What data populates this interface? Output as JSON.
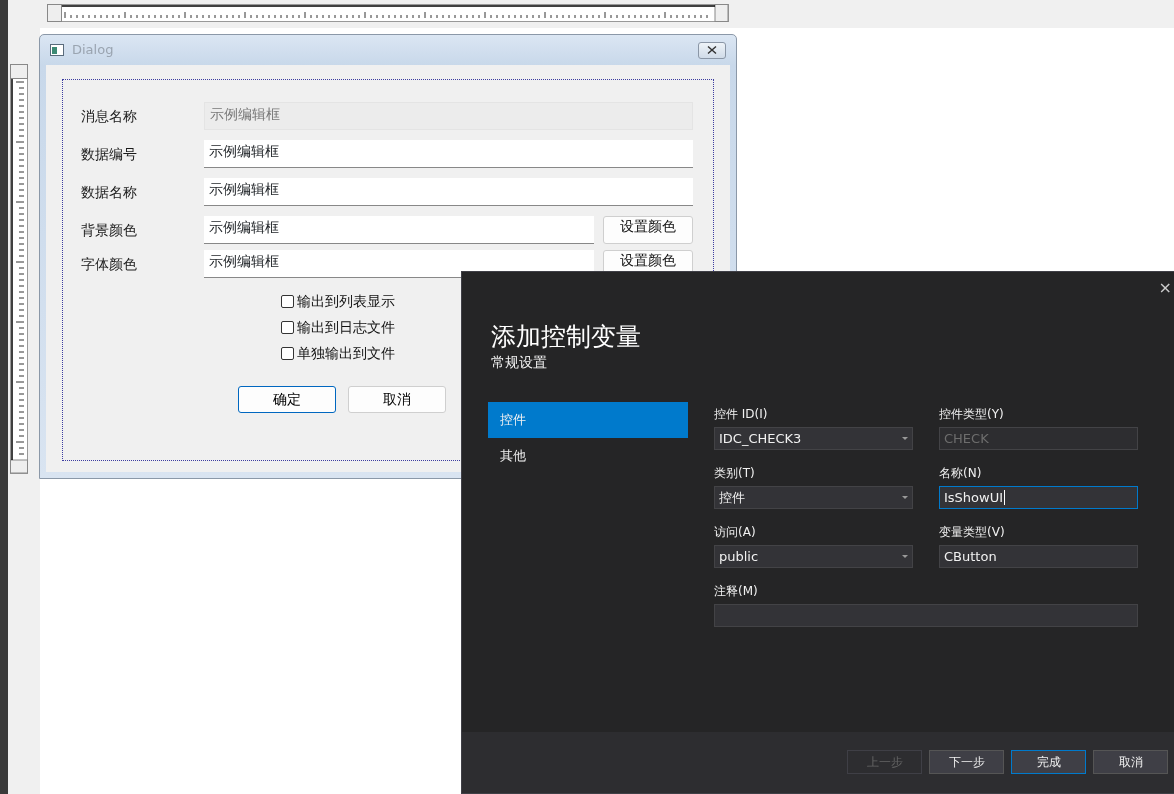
{
  "dialog": {
    "title": "Dialog",
    "fields": [
      {
        "label": "消息名称",
        "value": "示例编辑框",
        "disabled": true
      },
      {
        "label": "数据编号",
        "value": "示例编辑框",
        "disabled": false
      },
      {
        "label": "数据名称",
        "value": "示例编辑框",
        "disabled": false
      },
      {
        "label": "背景颜色",
        "value": "示例编辑框",
        "disabled": false,
        "button": "设置颜色"
      },
      {
        "label": "字体颜色",
        "value": "示例编辑框",
        "disabled": false,
        "button": "设置颜色"
      }
    ],
    "checkboxes": [
      {
        "label": "输出到列表显示",
        "checked": false
      },
      {
        "label": "输出到日志文件",
        "checked": false
      },
      {
        "label": "单独输出到文件",
        "checked": false
      }
    ],
    "buttons": [
      {
        "label": "确定",
        "default": true
      },
      {
        "label": "取消",
        "default": false
      }
    ]
  },
  "wizard": {
    "close": "×",
    "title": "添加控制变量",
    "subtitle": "常规设置",
    "nav": [
      {
        "label": "控件",
        "selected": true
      },
      {
        "label": "其他",
        "selected": false
      }
    ],
    "fields": [
      {
        "label": "控件 ID(I)",
        "value": "IDC_CHECK3",
        "kind": "dropdown",
        "disabled": false,
        "focused": false
      },
      {
        "label": "控件类型(Y)",
        "value": "CHECK",
        "kind": "text",
        "disabled": true,
        "focused": false
      },
      {
        "label": "类别(T)",
        "value": "控件",
        "kind": "dropdown",
        "disabled": false,
        "focused": false
      },
      {
        "label": "名称(N)",
        "value": "IsShowUI",
        "kind": "text",
        "disabled": false,
        "focused": true
      },
      {
        "label": "访问(A)",
        "value": "public",
        "kind": "dropdown",
        "disabled": false,
        "focused": false
      },
      {
        "label": "变量类型(V)",
        "value": "CButton",
        "kind": "text",
        "disabled": false,
        "focused": false
      },
      {
        "label": "注释(M)",
        "kind": "wide"
      }
    ],
    "buttons": [
      {
        "label": "上一步",
        "disabled": true,
        "focused": false
      },
      {
        "label": "下一步",
        "disabled": false,
        "focused": false
      },
      {
        "label": "完成",
        "disabled": false,
        "focused": true
      },
      {
        "label": "取消",
        "disabled": false,
        "focused": false
      }
    ]
  }
}
